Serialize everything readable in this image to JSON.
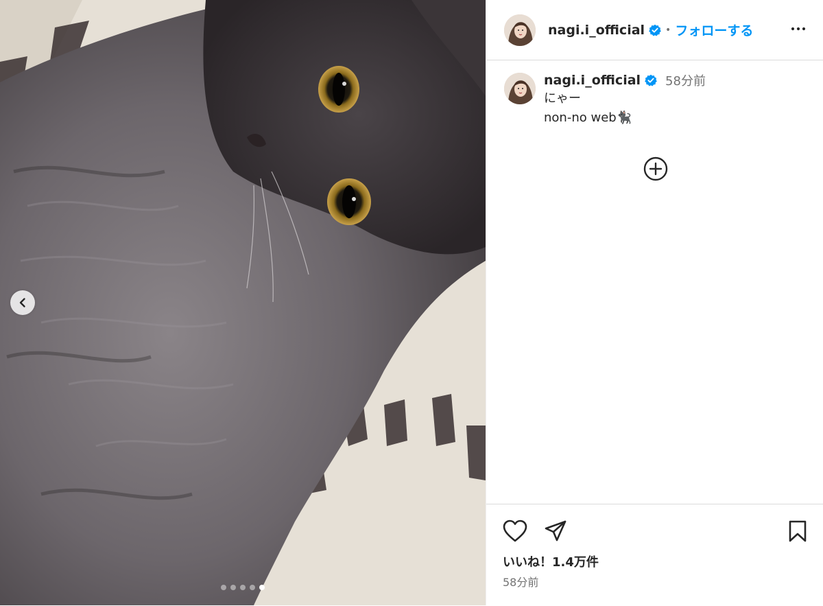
{
  "post": {
    "image_alt": "gray long-haired kitten lying on a white knit rug",
    "carousel": {
      "total_slides": 5,
      "active_slide": 5
    }
  },
  "header": {
    "username": "nagi.i_official",
    "separator": "•",
    "follow_label": "フォローする"
  },
  "caption": {
    "username": "nagi.i_official",
    "time": "58分前",
    "lines": [
      "にゃー",
      "non-no web🐈‍⬛"
    ]
  },
  "footer": {
    "likes": "いいね！1.4万件",
    "time": "58分前"
  },
  "colors": {
    "accent": "#0095f6",
    "verified": "#0095f6",
    "text": "#262626",
    "secondary": "#737373"
  },
  "icons": [
    "chevron-left-icon",
    "verified-badge-icon",
    "more-options-icon",
    "add-comment-icon",
    "heart-icon",
    "share-icon",
    "bookmark-icon"
  ]
}
